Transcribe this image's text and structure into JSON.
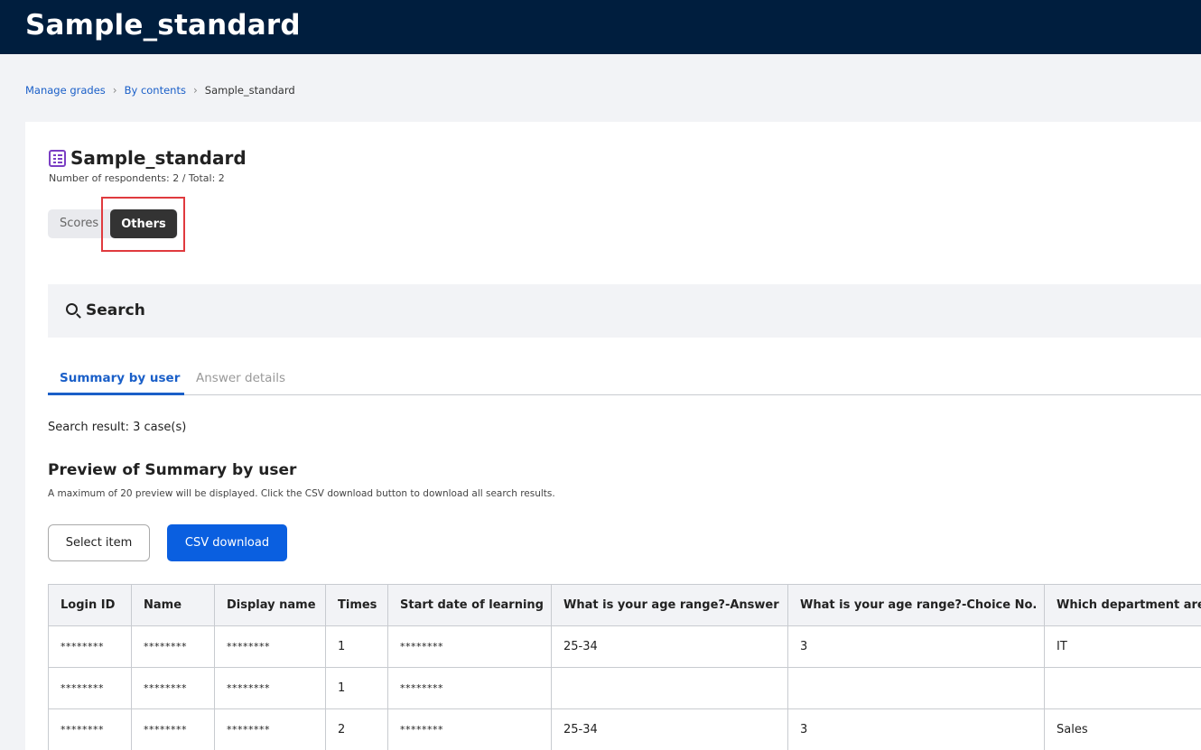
{
  "header": {
    "title": "Sample_standard"
  },
  "breadcrumb": {
    "items": [
      "Manage grades",
      "By contents"
    ],
    "current": "Sample_standard"
  },
  "page": {
    "title": "Sample_standard",
    "title_icon": "survey-list-icon",
    "respondents": "Number of respondents: 2 / Total: 2"
  },
  "view_tabs": {
    "scores": "Scores",
    "others": "Others",
    "selected": "Others"
  },
  "search": {
    "label": "Search",
    "icon": "search-icon"
  },
  "result_tabs": {
    "summary": "Summary by user",
    "answer": "Answer details",
    "active": "Summary by user"
  },
  "result_text": "Search result: 3 case(s)",
  "preview": {
    "title": "Preview of Summary by user",
    "note": "A maximum of 20 preview will be displayed. Click the CSV download button to download all search results."
  },
  "buttons": {
    "select_item": "Select item",
    "csv_download": "CSV download"
  },
  "table": {
    "headers": [
      "Login ID",
      "Name",
      "Display name",
      "Times",
      "Start date of learning",
      "What is your age range?-Answer",
      "What is your age range?-Choice No.",
      "Which department are"
    ],
    "rows": [
      [
        "********",
        "********",
        "********",
        "1",
        "********",
        "25-34",
        "3",
        "IT"
      ],
      [
        "********",
        "********",
        "********",
        "1",
        "********",
        "",
        "",
        ""
      ],
      [
        "********",
        "********",
        "********",
        "2",
        "********",
        "25-34",
        "3",
        "Sales"
      ]
    ]
  },
  "colors": {
    "topbar": "#001e3e",
    "accent": "#1a5fc8",
    "primary_button": "#0a5fe0",
    "highlight": "#e03a3e"
  }
}
